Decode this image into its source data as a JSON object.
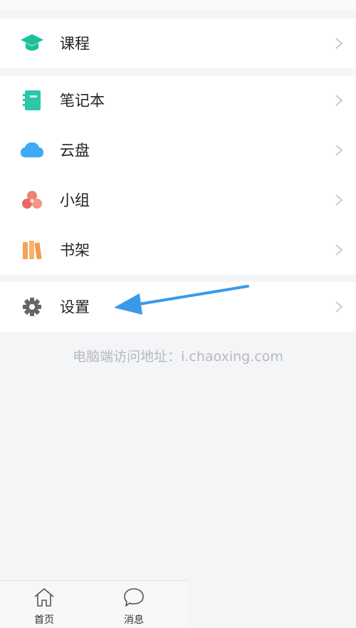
{
  "menu": {
    "course": "课程",
    "notebook": "笔记本",
    "cloud": "云盘",
    "group": "小组",
    "bookshelf": "书架",
    "settings": "设置"
  },
  "footer_note": "电脑端访问地址：i.chaoxing.com",
  "tabs": {
    "home": "首页",
    "messages": "消息"
  },
  "icons": {
    "course": "graduation-cap-icon",
    "notebook": "notebook-icon",
    "cloud": "cloud-icon",
    "group": "group-circles-icon",
    "bookshelf": "books-icon",
    "settings": "gear-icon"
  },
  "colors": {
    "course": "#1cbf9b",
    "notebook": "#2bc7a8",
    "cloud": "#3fa9f5",
    "group": "#f08070",
    "bookshelf": "#f5a25a",
    "settings": "#666666",
    "annotation_arrow": "#3b9ae8"
  }
}
